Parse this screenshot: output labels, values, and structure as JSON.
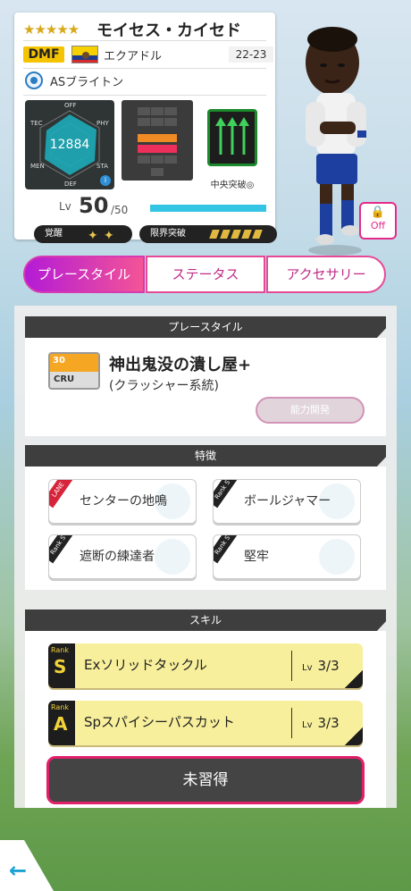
{
  "player": {
    "stars": "★★★★★",
    "name": "モイセス・カイセド",
    "position": "DMF",
    "nation": "エクアドル",
    "season": "22-23",
    "club": "ASブライトン",
    "radar": {
      "labels": {
        "off": "OFF",
        "tec": "TEC",
        "phy": "PHY",
        "men": "MEN",
        "sta": "STA",
        "def": "DEF"
      },
      "rating": "12884",
      "info_icon": "i"
    },
    "tactic": "中央突破◎",
    "level": {
      "label": "Lv",
      "value": "50",
      "max": "/50",
      "progress": 1.0
    },
    "awakening_label": "覚醒",
    "limit_break_label": "限界突破"
  },
  "kit_toggle": {
    "label": "Off",
    "icon": "lock-icon"
  },
  "tabs": [
    {
      "label": "プレースタイル",
      "active": true
    },
    {
      "label": "ステータス",
      "active": false
    },
    {
      "label": "アクセサリー",
      "active": false
    }
  ],
  "playstyle": {
    "header": "プレースタイル",
    "icon_number": "30",
    "icon_code": "CRU",
    "name": "神出鬼没の潰し屋+",
    "sub": "(クラッシャー系統)",
    "button": "能力開発"
  },
  "traits": {
    "header": "特徴",
    "items": [
      {
        "label": "センターの地鳴",
        "tag": "LANE"
      },
      {
        "label": "ボールジャマー",
        "tag": "Rank S"
      },
      {
        "label": "遮断の練達者",
        "tag": "Rank S"
      },
      {
        "label": "堅牢",
        "tag": "Rank S"
      }
    ]
  },
  "skills": {
    "header": "スキル",
    "items": [
      {
        "rank_word": "Rank",
        "rank": "S",
        "name": "Exソリッドタックル",
        "lv_label": "Lv",
        "lv": "3/3"
      },
      {
        "rank_word": "Rank",
        "rank": "A",
        "name": "Spスパイシーパスカット",
        "lv_label": "Lv",
        "lv": "3/3"
      }
    ],
    "unlearned_button": "未習得"
  },
  "colors": {
    "accent_pink": "#e64a97",
    "tab_gradient_start": "#b31bd6",
    "rank_gold": "#f2d23a",
    "level_bar": "#35c5e4",
    "back_arrow": "#1aa2d6"
  }
}
